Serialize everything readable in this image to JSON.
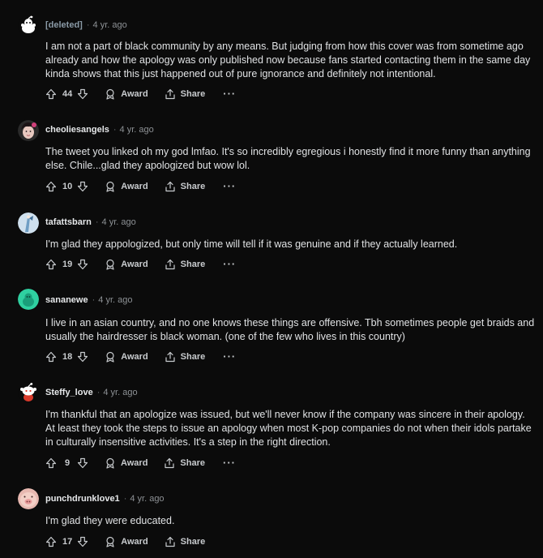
{
  "comments": [
    {
      "username": "[deleted]",
      "time": "4 yr. ago",
      "text": "I am not a part of black community by any means. But judging from how this cover was from sometime ago already and how the apology was only published now because fans started contacting them in the same day kinda shows that this just happened out of pure ignorance and definitely not intentional.",
      "votes": "44",
      "award_label": "Award",
      "share_label": "Share",
      "more_label": "···",
      "avatar_icon": "snoo-avatar-icon"
    },
    {
      "username": "cheoliesangels",
      "time": "4 yr. ago",
      "text": "The tweet you linked oh my god lmfao. It's so incredibly egregious i honestly find it more funny than anything else. Chile...glad they apologized but wow lol.",
      "votes": "10",
      "award_label": "Award",
      "share_label": "Share",
      "more_label": "···",
      "avatar_icon": "user-avatar-icon"
    },
    {
      "username": "tafattsbarn",
      "time": "4 yr. ago",
      "text": "I'm glad they appologized, but only time will tell if it was genuine and if they actually learned.",
      "votes": "19",
      "award_label": "Award",
      "share_label": "Share",
      "more_label": "···",
      "avatar_icon": "user-avatar-icon"
    },
    {
      "username": "sananewe",
      "time": "4 yr. ago",
      "text": "I live in an asian country, and no one knows these things are offensive. Tbh sometimes people get braids and usually the hairdresser is black woman. (one of the few who lives in this country)",
      "votes": "18",
      "award_label": "Award",
      "share_label": "Share",
      "more_label": "···",
      "avatar_icon": "user-avatar-icon"
    },
    {
      "username": "Steffy_love",
      "time": "4 yr. ago",
      "text": "I'm thankful that an apologize was issued, but we'll never know if the company was sincere in their apology. At least they took the steps to issue an apology when most K-pop companies do not when their idols partake in culturally insensitive activities. It's a step in the right direction.",
      "votes": "9",
      "award_label": "Award",
      "share_label": "Share",
      "more_label": "···",
      "avatar_icon": "snoo-avatar-icon"
    },
    {
      "username": "punchdrunklove1",
      "time": "4 yr. ago",
      "text": "I'm glad they were educated.",
      "votes": "17",
      "award_label": "Award",
      "share_label": "Share",
      "more_label": "",
      "avatar_icon": "user-avatar-icon"
    }
  ],
  "colors": {
    "background": "#0b0b0b",
    "text": "#e0e2e4",
    "muted": "#8d9195",
    "deleted_username": "#8a9aa6"
  }
}
